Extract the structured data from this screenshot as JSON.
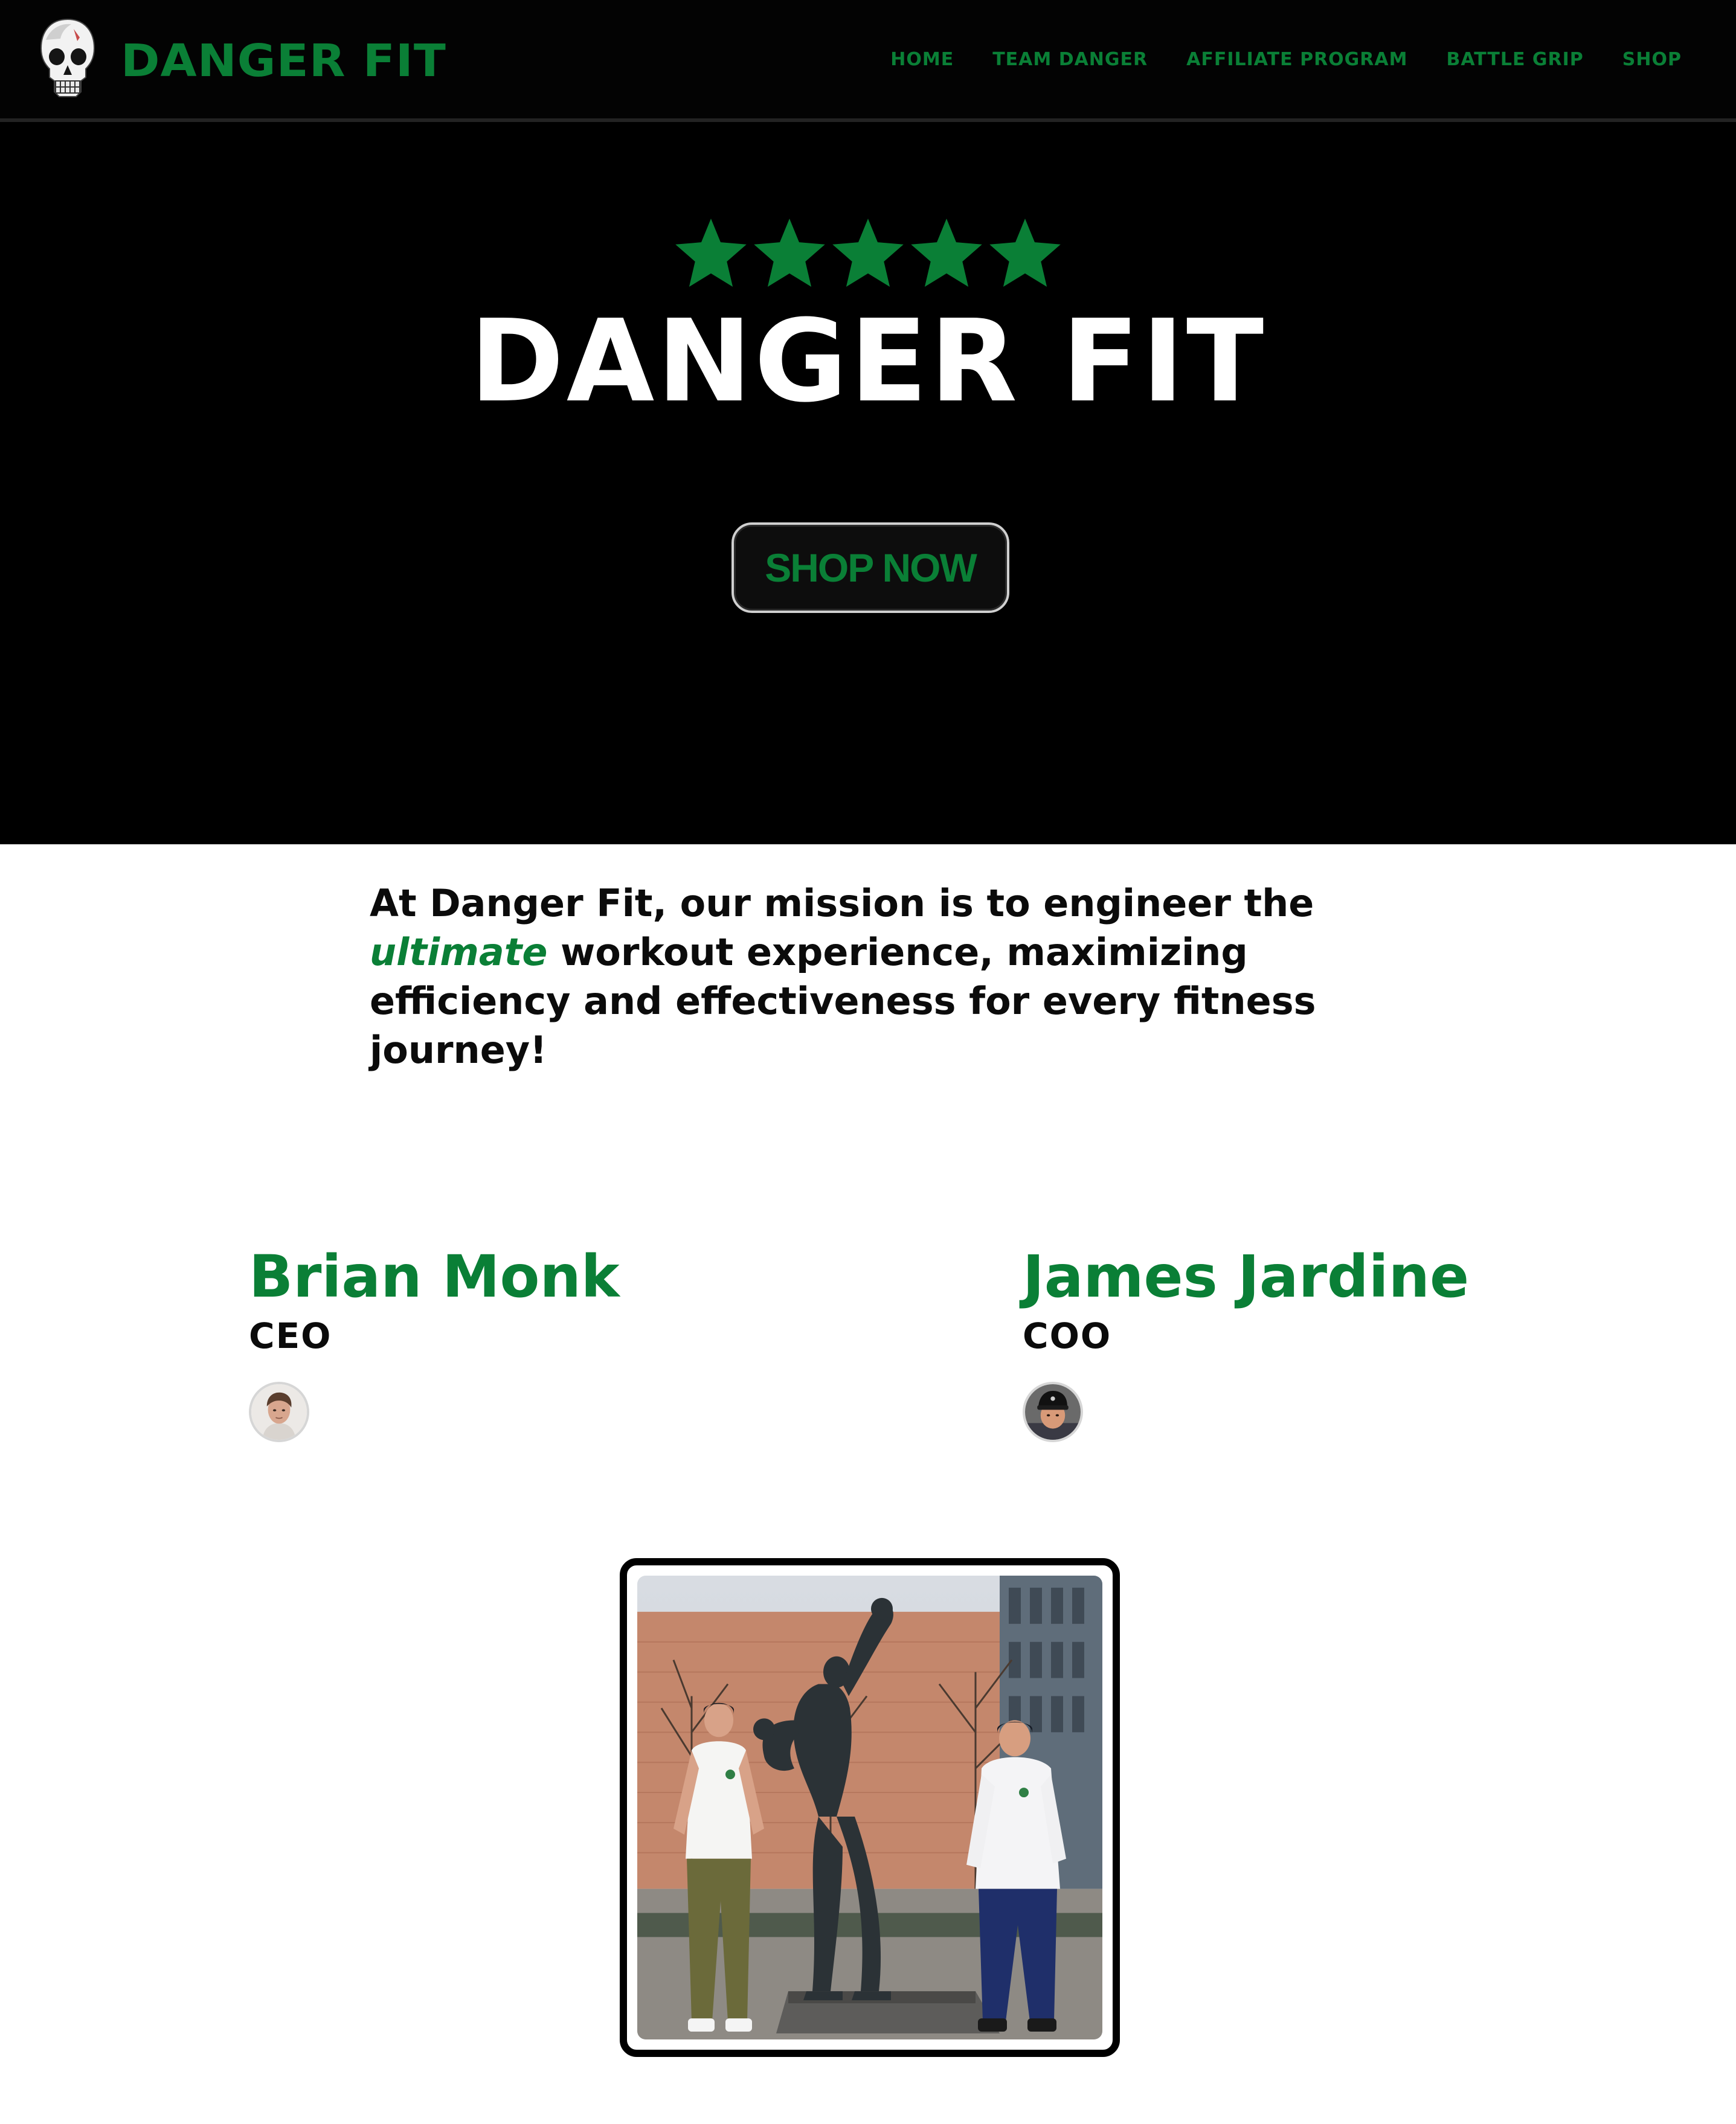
{
  "nav": {
    "brand": "DANGER FIT",
    "logo_icon": "skull-icon",
    "links": [
      "HOME",
      "TEAM DANGER",
      "AFFILIATE PROGRAM",
      "BATTLE GRIP",
      "SHOP"
    ]
  },
  "hero": {
    "rating_icon": "star-icon",
    "rating": 5,
    "title": "DANGER FIT",
    "cta_label": "SHOP NOW"
  },
  "mission": {
    "part1": "At Danger Fit, our mission is to engineer the ",
    "emphasis": "ultimate",
    "part2": " workout experience, maximizing efficiency and effectiveness for every fitness journey!"
  },
  "team": [
    {
      "name": "Brian Monk",
      "role": "CEO"
    },
    {
      "name": "James Jardine",
      "role": "COO"
    }
  ],
  "colors": {
    "brand_green": "#0a7f36",
    "black": "#000000",
    "white": "#ffffff"
  }
}
